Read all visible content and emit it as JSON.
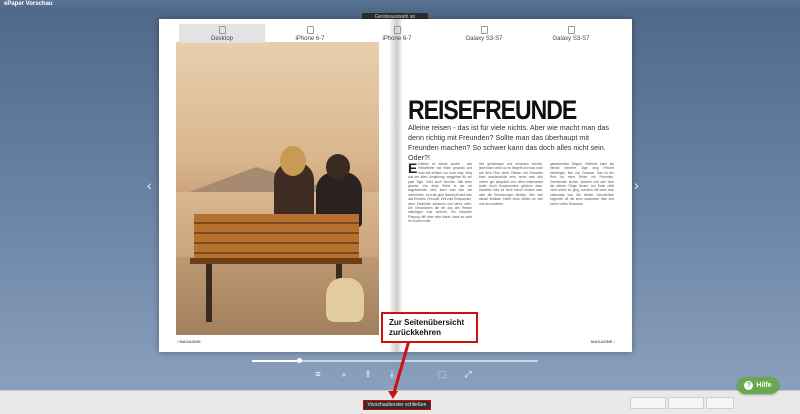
{
  "window": {
    "title": "ePaper Vorschau"
  },
  "device_toggle": {
    "label": "Geräteauswahl an"
  },
  "tabs": [
    {
      "label": "Desktop",
      "active": true
    },
    {
      "label": "iPhone 6-7"
    },
    {
      "label": "iPhone 6-7"
    },
    {
      "label": "Galaxy S3-S7"
    },
    {
      "label": "Galaxy S3-S7"
    }
  ],
  "article": {
    "headline": "REISEFREUNDE",
    "intro": "Alleine reisen - das ist für viele nichts. Aber wie macht man das denn richtig mit Freunden? Sollte man das überhaupt mit Freunden machen? So schwer kann das doch alles nicht sein. Oder?!",
    "dropcap": "E",
    "col1": "inblicke es wieder soweit - das Reisefieber hat einen gepackt und man will einfach nur noch weg. Weg aus der alten Umgebung, weggehen für ein paar Tage. Oder auch Wochen. Alle oben gesetzt. Von einer Reise in der wir angekommen sind, kann man sich viel vornehmen. Und die gute Nachricht wird sein das Erlebnis. Freunde, Zeit zum Entspannen, neue Eindrücke sammeln und vieles mehr. Die Geschichten die wir aus den Reisen mitbringen sind wertvoll. Ein bisschen Planung hilft aber sehr dabei, dass es nicht im Chaos endet.",
    "col2": "ihre gemeinsam und erkunden möchte, jedermann weiß wo es hingeht und was noch auf dem Plan steht. Reisen mit Freunden kann wunderschön sein, wenn man sich vorher gut abspricht und offen miteinander redet. Auch Kompromisse gehören dazu. Daneben wird es nicht immer einfach sein, aber die Erinnerungen bleiben. Wer sich darauf einlässt, findet neue Seiten an sich und den anderen.",
    "col3": "gesammelten Dingen. Vielmehr kann auf einmal mehrere Tage lang Freizeit verbringen, fern von Zuhause. Das ist der Reiz an einer Reise mit Freunden. Gemeinsam lachen, staunen und sich über die kleinen Dinge freuen. Am Ende zählt nicht wohin es ging, sondern mit wem man unterwegs war. Die besten Geschichten beginnen oft mit einer spontanen Idee und einem vollen Rucksack.",
    "footer_left": "MAGAZINE",
    "footer_right": "MAGAZINE"
  },
  "callout": {
    "line1": "Zur Seitenübersicht",
    "line2": "zurückkehren"
  },
  "status": {
    "close_label": "Vorschaufenster schließen"
  },
  "help": {
    "label": "Hilfe",
    "icon": "?"
  },
  "colors": {
    "accent": "#d01010",
    "help": "#6aa84f"
  }
}
